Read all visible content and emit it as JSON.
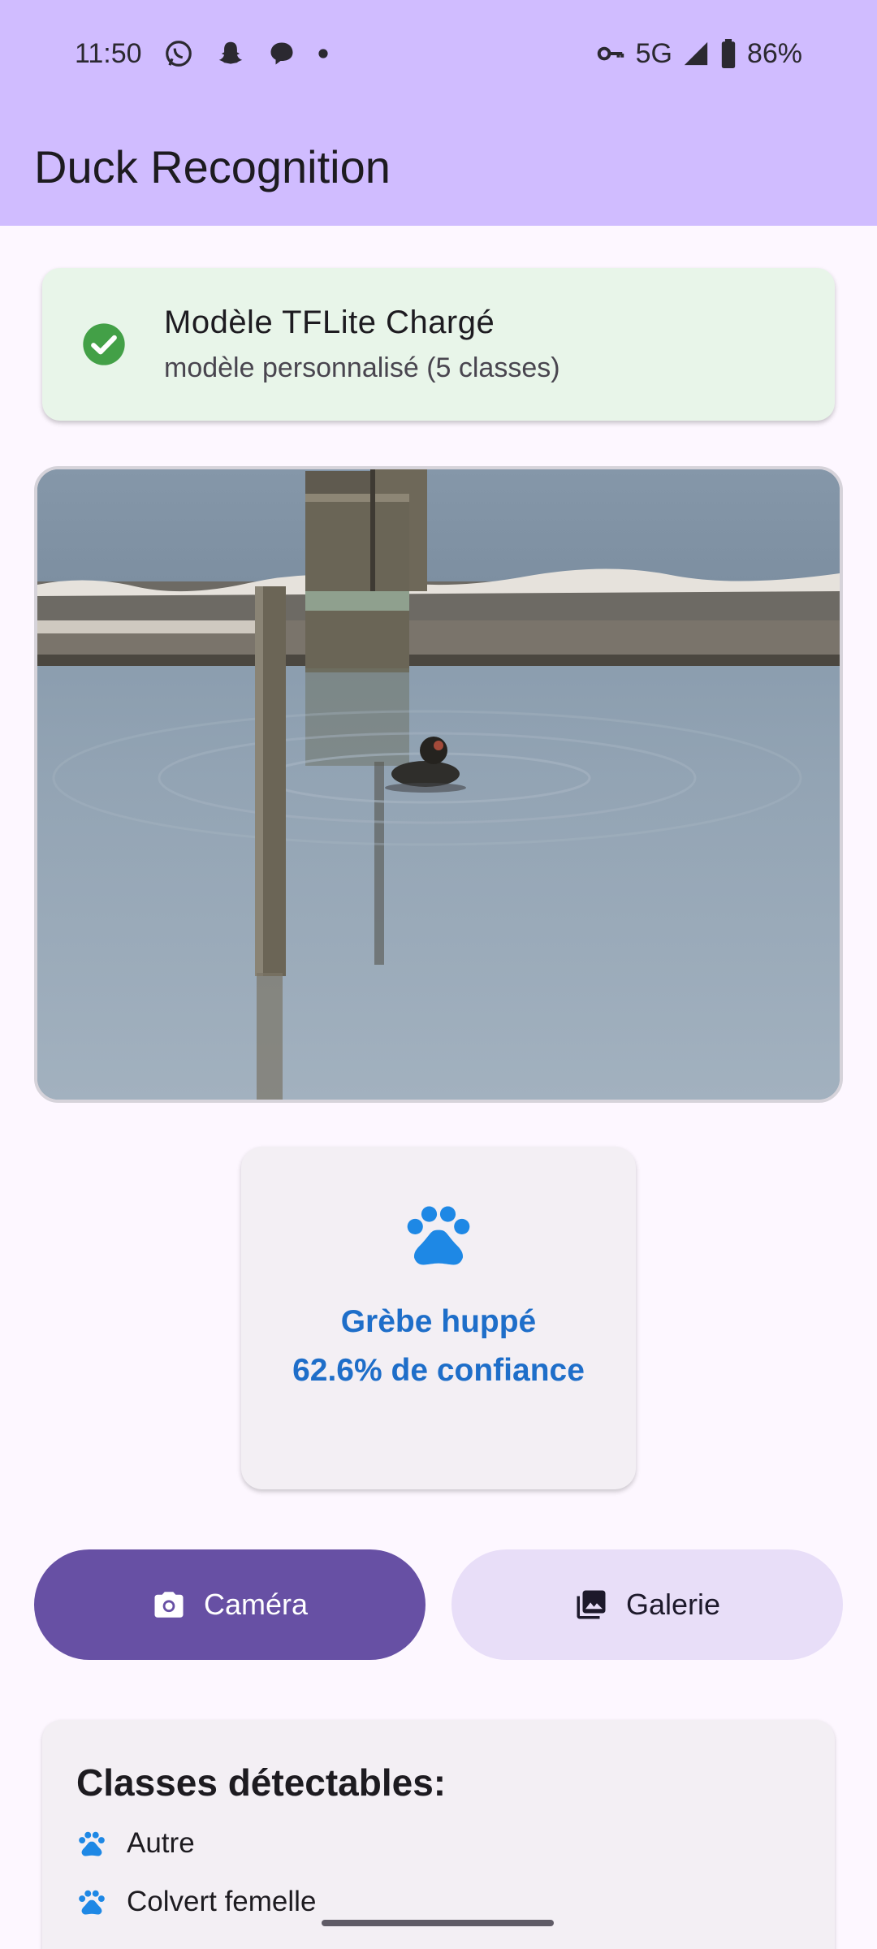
{
  "status_bar": {
    "time": "11:50",
    "network": "5G",
    "battery": "86%",
    "left_icons": [
      "whatsapp-icon",
      "snapchat-icon",
      "messenger-icon",
      "dot-icon"
    ],
    "right_icons": [
      "vpn-key-icon",
      "signal-icon",
      "battery-icon"
    ]
  },
  "app_bar": {
    "title": "Duck Recognition",
    "background": "#d0bcff"
  },
  "model_status": {
    "title": "Modèle TFLite Chargé",
    "subtitle": "modèle personnalisé (5 classes)",
    "icon": "check-circle-icon",
    "color": "#43a047"
  },
  "photo": {
    "description_icon": "duck-photo"
  },
  "result": {
    "species": "Grèbe huppé",
    "confidence_text": "62.6% de confiance",
    "icon": "paw-icon",
    "color": "#1e6ec9"
  },
  "buttons": {
    "camera": {
      "label": "Caméra",
      "icon": "camera-icon"
    },
    "gallery": {
      "label": "Galerie",
      "icon": "photo-library-icon"
    }
  },
  "classes": {
    "title": "Classes détectables:",
    "items": [
      {
        "label": "Autre"
      },
      {
        "label": "Colvert femelle"
      }
    ]
  }
}
